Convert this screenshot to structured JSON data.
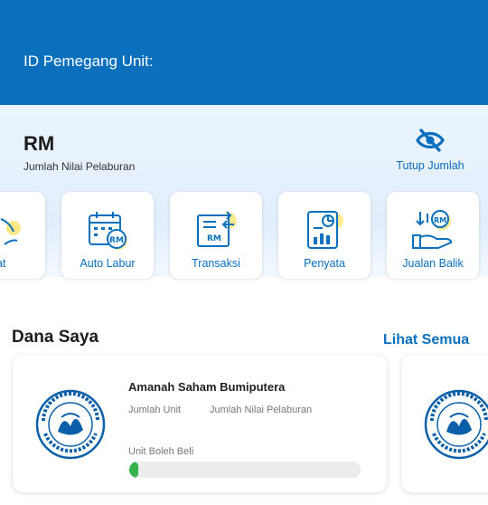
{
  "header": {
    "unit_holder_label": "ID Pemegang Unit:"
  },
  "summary": {
    "currency": "RM",
    "total_label": "Jumlah Nilai Pelaburan",
    "hide_label": "Tutup Jumlah"
  },
  "actions": [
    {
      "label": "at",
      "icon": "partial-icon"
    },
    {
      "label": "Auto Labur",
      "icon": "calendar-rm-icon"
    },
    {
      "label": "Transaksi",
      "icon": "transfer-document-icon"
    },
    {
      "label": "Penyata",
      "icon": "statement-chart-icon"
    },
    {
      "label": "Jualan Balik",
      "icon": "hand-rm-icon"
    }
  ],
  "funds_section": {
    "title": "Dana Saya",
    "see_all": "Lihat Semua"
  },
  "fund": {
    "name": "Amanah Saham Bumiputera",
    "unit_label": "Jumlah Unit",
    "value_label": "Jumlah Nilai Pelaburan",
    "can_buy_label": "Unit Boleh Beli",
    "progress_fraction": 0.04,
    "logo_text": "AMANAH SAHAM BUMIPUTERA"
  },
  "colors": {
    "primary": "#0a6fbd",
    "progress": "#35b24a",
    "icon_yellow": "#fdd835"
  }
}
